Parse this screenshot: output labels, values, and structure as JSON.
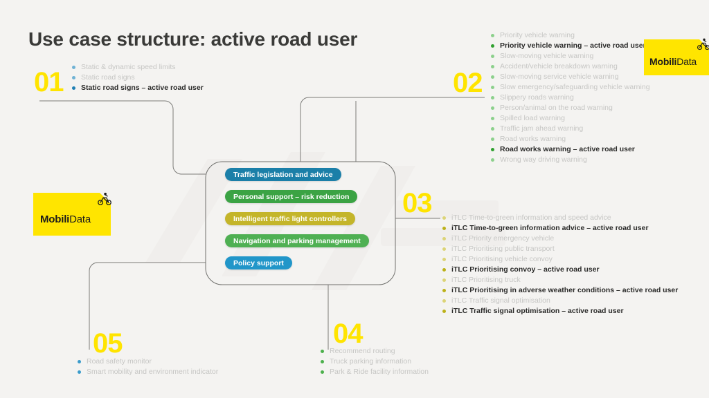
{
  "page": {
    "title": "Use case structure: active road user",
    "background_color": "#f4f3f1"
  },
  "colors": {
    "yellow": "#ffe400",
    "logo_yellow": "#ffe500",
    "blue_pill": "#1b7fa8",
    "blue_pill_light": "#2196c9",
    "green_pill": "#3ba344",
    "green_pill_light": "#4fb053",
    "olive_pill": "#c4b52a",
    "bullet_blue": "#2e8fc0",
    "bullet_green": "#4cb04c",
    "bullet_olive": "#c9bf3a",
    "text_muted": "#c6c6c4",
    "text_dark": "#2b2b2a",
    "wire": "#7b7b78"
  },
  "center": {
    "pills": [
      {
        "label": "Traffic legislation and advice",
        "color": "#1b7fa8"
      },
      {
        "label": "Personal support – risk reduction",
        "color": "#3ba344"
      },
      {
        "label": "Intelligent traffic light controllers",
        "color": "#c4b52a"
      },
      {
        "label": "Navigation and parking management",
        "color": "#4fb053"
      },
      {
        "label": "Policy support",
        "color": "#2196c9"
      }
    ]
  },
  "groups": {
    "g01": {
      "number": "01",
      "bullet_style": "blue",
      "items": [
        {
          "text": "Static & dynamic speed limits",
          "highlight": false
        },
        {
          "text": "Static road signs",
          "highlight": false
        },
        {
          "text": "Static road signs – active road user",
          "highlight": true
        }
      ]
    },
    "g02": {
      "number": "02",
      "bullet_style": "green",
      "items": [
        {
          "text": "Priority vehicle warning",
          "highlight": false
        },
        {
          "text": "Priority vehicle warning – active road user",
          "highlight": true
        },
        {
          "text": "Slow-moving vehicle warning",
          "highlight": false
        },
        {
          "text": "Accident/vehicle breakdown warning",
          "highlight": false
        },
        {
          "text": "Slow-moving service vehicle warning",
          "highlight": false
        },
        {
          "text": "Slow emergency/safeguarding vehicle warning",
          "highlight": false
        },
        {
          "text": "Slippery roads warning",
          "highlight": false
        },
        {
          "text": "Person/animal on the road warning",
          "highlight": false
        },
        {
          "text": "Spilled load warning",
          "highlight": false
        },
        {
          "text": "Traffic jam ahead warning",
          "highlight": false
        },
        {
          "text": "Road works warning",
          "highlight": false
        },
        {
          "text": "Road works warning – active road user",
          "highlight": true
        },
        {
          "text": "Wrong way driving warning",
          "highlight": false
        }
      ]
    },
    "g03": {
      "number": "03",
      "bullet_style": "olive",
      "items": [
        {
          "text": "iTLC Time-to-green information and speed advice",
          "highlight": false
        },
        {
          "text": "iTLC Time-to-green information advice – active road user",
          "highlight": true
        },
        {
          "text": "iTLC Priority emergency vehicle",
          "highlight": false
        },
        {
          "text": "iTLC Prioritising public transport",
          "highlight": false
        },
        {
          "text": "iTLC Prioritising vehicle convoy",
          "highlight": false
        },
        {
          "text": "iTLC Prioritising convoy – active road user",
          "highlight": true
        },
        {
          "text": "iTLC Prioritising truck",
          "highlight": false
        },
        {
          "text": "iTLC Prioritising in adverse weather conditions – active road user",
          "highlight": true
        },
        {
          "text": "iTLC Traffic signal optimisation",
          "highlight": false
        },
        {
          "text": "iTLC Traffic signal optimisation – active road user",
          "highlight": true
        }
      ]
    },
    "g04": {
      "number": "04",
      "bullet_style": "green",
      "items": [
        {
          "text": "Recommend routing",
          "highlight": false
        },
        {
          "text": "Truck parking information",
          "highlight": false
        },
        {
          "text": "Park & Ride facility information",
          "highlight": false
        }
      ]
    },
    "g05": {
      "number": "05",
      "bullet_style": "blue",
      "items": [
        {
          "text": "Road safety monitor",
          "highlight": false
        },
        {
          "text": "Smart mobility and environment indicator",
          "highlight": false
        }
      ]
    }
  },
  "logos": {
    "left": {
      "name_bold": "Mobili",
      "name_light": "Data",
      "icon": "cyclist-icon"
    },
    "right": {
      "name_bold": "Mobili",
      "name_light": "Data",
      "icon": "cyclist-icon"
    }
  }
}
